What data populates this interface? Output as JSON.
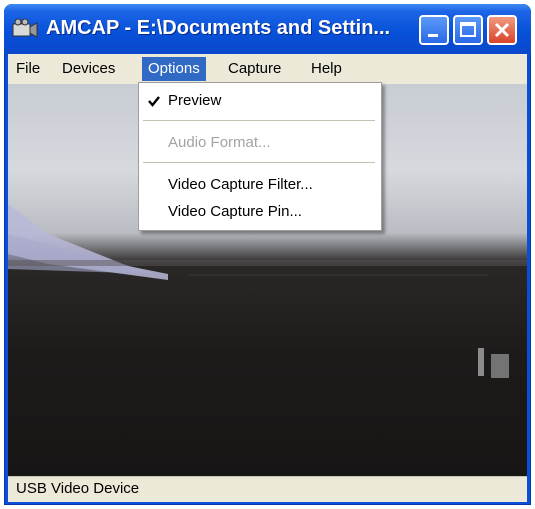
{
  "window": {
    "title": "AMCAP - E:\\Documents and Settin...",
    "colors": {
      "titlebar": "#0752d9",
      "menu_highlight": "#316ac5",
      "close": "#d9432b"
    }
  },
  "titlebar_buttons": {
    "minimize_icon": "minimize-icon",
    "maximize_icon": "maximize-icon",
    "close_icon": "close-icon"
  },
  "menubar": {
    "items": [
      {
        "label": "File"
      },
      {
        "label": "Devices"
      },
      {
        "label": "Options",
        "active": true
      },
      {
        "label": "Capture"
      },
      {
        "label": "Help"
      }
    ]
  },
  "options_menu": {
    "items": [
      {
        "label": "Preview",
        "checked": true
      },
      {
        "label": "Audio Format...",
        "disabled": true
      },
      {
        "label": "Video Capture Filter..."
      },
      {
        "label": "Video Capture Pin..."
      }
    ]
  },
  "statusbar": {
    "text": "USB Video Device"
  }
}
